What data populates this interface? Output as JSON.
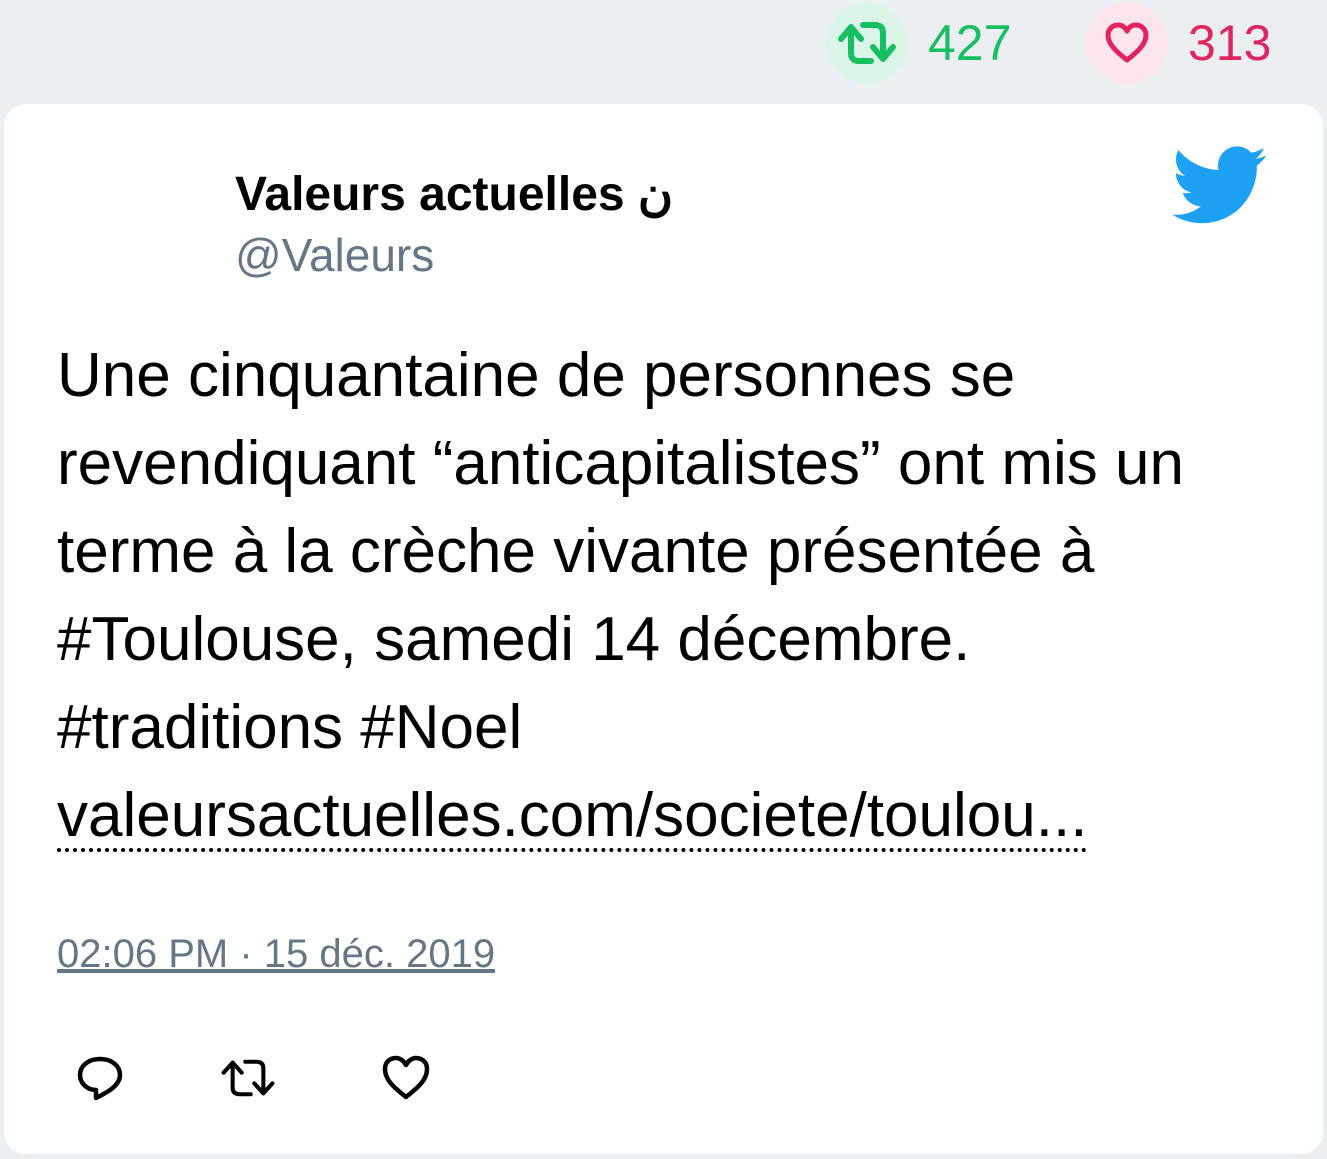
{
  "stats": {
    "retweets": "427",
    "likes": "313",
    "retweet_icon": "retweet-icon",
    "like_icon": "heart-icon",
    "retweet_color": "#17bf63",
    "like_color": "#e0245e"
  },
  "tweet": {
    "author_name": "Valeurs actuelles ن",
    "author_handle": "@Valeurs",
    "brand_icon": "twitter-bird-icon",
    "brand_color": "#1da1f2",
    "text_lines": [
      "Une cinquantaine de personnes se",
      "revendiquant “anticapitalistes” ont mis un",
      "terme à la crèche vivante présentée à",
      "#Toulouse, samedi 14 décembre.",
      "#traditions #Noel"
    ],
    "link_text": "valeursactuelles.com/societe/toulou...",
    "timestamp": "02:06 PM · 15 déc. 2019"
  },
  "actions": {
    "reply_icon": "reply-icon",
    "retweet_icon": "retweet-icon",
    "like_icon": "heart-icon"
  }
}
